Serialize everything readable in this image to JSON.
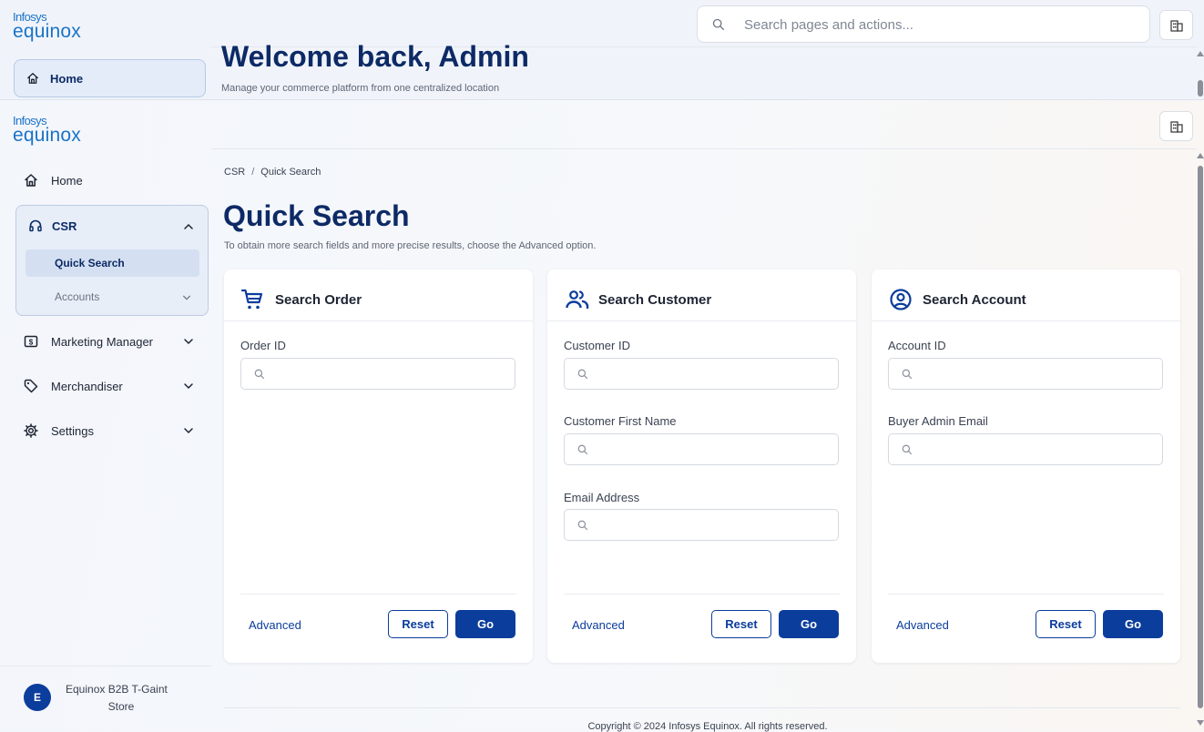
{
  "logo": {
    "line1": "Infosys",
    "line2": "equinox"
  },
  "overlay": {
    "search_placeholder": "Search pages and actions...",
    "home_label": "Home",
    "welcome_title": "Welcome back, Admin",
    "welcome_subtitle": "Manage your commerce platform from one centralized location"
  },
  "sidebar": {
    "home": "Home",
    "csr": "CSR",
    "quick_search": "Quick Search",
    "accounts": "Accounts",
    "marketing_manager": "Marketing Manager",
    "merchandiser": "Merchandiser",
    "settings": "Settings",
    "avatar_initial": "E",
    "store_name": "Equinox B2B T-Gaint",
    "store_label": "Store"
  },
  "breadcrumb": {
    "parent": "CSR",
    "separator": "/",
    "current": "Quick Search"
  },
  "page": {
    "title": "Quick Search",
    "subtitle": "To obtain more search fields and more precise results, choose the Advanced option."
  },
  "cards": {
    "order": {
      "title": "Search Order",
      "icon": "cart-icon",
      "fields": [
        "Order ID"
      ]
    },
    "customer": {
      "title": "Search Customer",
      "icon": "users-icon",
      "fields": [
        "Customer ID",
        "Customer First Name",
        "Email Address"
      ]
    },
    "account": {
      "title": "Search Account",
      "icon": "user-circle-icon",
      "fields": [
        "Account ID",
        "Buyer Admin Email"
      ]
    }
  },
  "actions": {
    "advanced": "Advanced",
    "reset": "Reset",
    "go": "Go"
  },
  "footer": {
    "copyright": "Copyright © 2024 Infosys Equinox. All rights reserved."
  },
  "colors": {
    "primary": "#0b3d9c",
    "heading": "#0d2a66",
    "logo": "#1a73c7"
  }
}
